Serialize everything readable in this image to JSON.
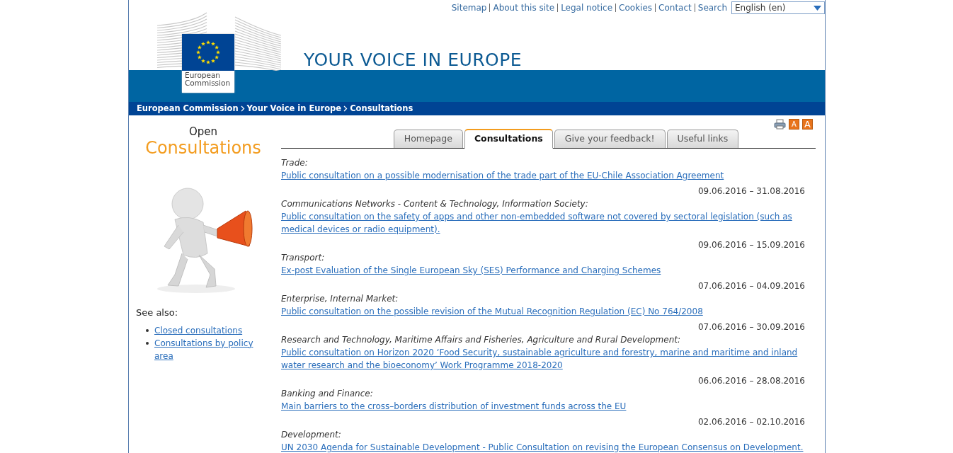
{
  "top_links": [
    "Sitemap",
    "About this site",
    "Legal notice",
    "Cookies",
    "Contact",
    "Search"
  ],
  "language": {
    "value": "English (en)"
  },
  "logo": {
    "label": "European Commission"
  },
  "site_title": "YOUR VOICE IN EUROPE",
  "breadcrumb": [
    "European Commission",
    "Your Voice in Europe",
    "Consultations"
  ],
  "sidebar": {
    "heading_small": "Open",
    "heading_large": "Consultations",
    "see_also": "See also:",
    "links": [
      "Closed consultations",
      "Consultations by policy area"
    ]
  },
  "tools": {
    "text_size_buttons": [
      "A",
      "A"
    ]
  },
  "tabs": [
    {
      "label": "Homepage",
      "selected": false
    },
    {
      "label": "Consultations",
      "selected": true
    },
    {
      "label": "Give your feedback!",
      "selected": false
    },
    {
      "label": "Useful links",
      "selected": false
    }
  ],
  "consultations": [
    {
      "category": "Trade:",
      "title": "Public consultation on a possible modernisation of the trade part of the EU-Chile Association Agreement",
      "dates": "09.06.2016 – 31.08.2016"
    },
    {
      "category": "Communications Networks - Content & Technology, Information Society:",
      "title": "Public consultation on the safety of apps and other non-embedded software not covered by sectoral legislation (such as medical devices or radio equipment).",
      "dates": "09.06.2016 – 15.09.2016"
    },
    {
      "category": "Transport:",
      "title": "Ex-post Evaluation of the Single European Sky (SES) Performance and Charging Schemes",
      "dates": "07.06.2016 – 04.09.2016"
    },
    {
      "category": "Enterprise, Internal Market:",
      "title": "Public consultation on the possible revision of the Mutual Recognition Regulation (EC) No 764/2008",
      "dates": "07.06.2016 – 30.09.2016"
    },
    {
      "category": "Research and Technology, Maritime Affairs and Fisheries, Agriculture and Rural Development:",
      "title": "Public consultation on Horizon 2020 ‘Food Security, sustainable agriculture and forestry, marine and maritime and inland water research and the bioeconomy’ Work Programme 2018-2020",
      "dates": "06.06.2016 – 28.08.2016"
    },
    {
      "category": "Banking and Finance:",
      "title": "Main barriers to the cross–borders distribution of investment funds across the EU",
      "dates": "02.06.2016 – 02.10.2016"
    },
    {
      "category": "Development:",
      "title": "UN 2030 Agenda for Sustainable Development  - Public Consultation on revising the European Consensus on Development."
    }
  ]
}
